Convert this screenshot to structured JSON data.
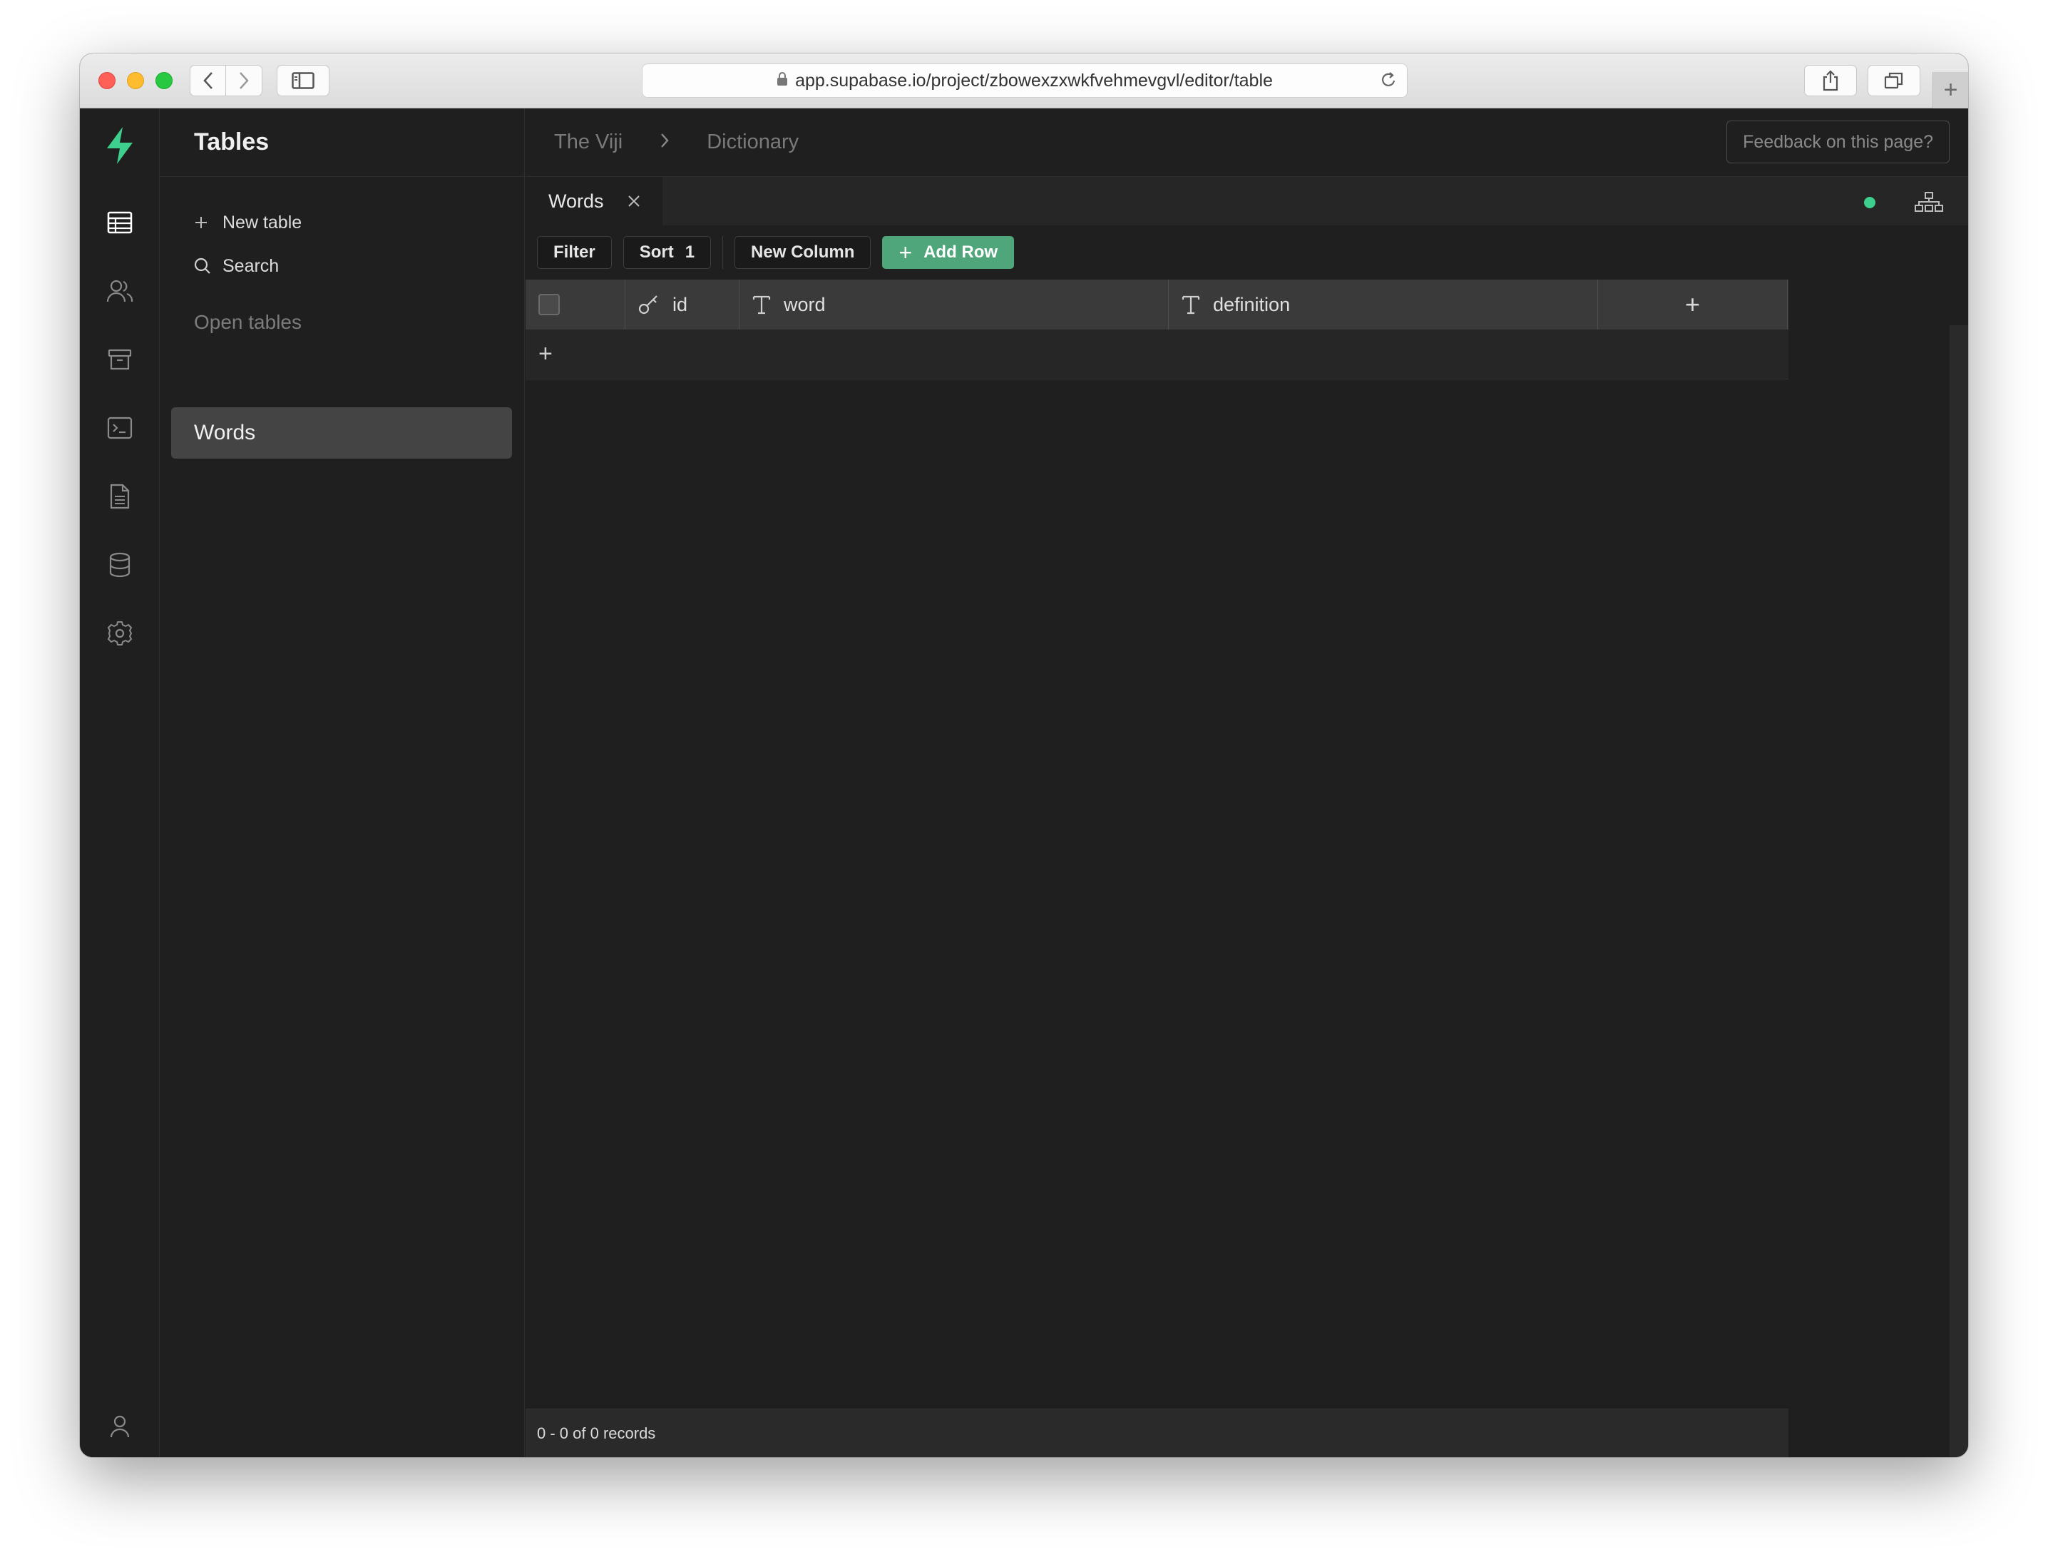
{
  "browser": {
    "url": "app.supabase.io/project/zbowexzxwkfvehmevgvl/editor/table"
  },
  "sidebar_panel": {
    "title": "Tables",
    "new_table_label": "New table",
    "search_label": "Search",
    "open_tables_label": "Open tables",
    "open_tables": [
      {
        "label": "Words"
      }
    ]
  },
  "topbar": {
    "breadcrumb": [
      "The Viji",
      "Dictionary"
    ],
    "feedback_label": "Feedback on this page?"
  },
  "tabs": [
    {
      "label": "Words"
    }
  ],
  "toolbar": {
    "filter_label": "Filter",
    "sort_label": "Sort",
    "sort_count": "1",
    "new_column_label": "New Column",
    "add_row_label": "Add Row"
  },
  "grid": {
    "columns": [
      {
        "name": "id",
        "type_icon": "key-icon"
      },
      {
        "name": "word",
        "type_icon": "text-type-icon"
      },
      {
        "name": "definition",
        "type_icon": "text-type-icon"
      }
    ],
    "add_column_glyph": "+",
    "add_row_glyph": "+"
  },
  "footer": {
    "records_text": "0 - 0 of 0 records"
  },
  "colors": {
    "accent": "#3ecf8e",
    "add_row_button": "#4fa67b",
    "background": "#1f1f1f",
    "header_row": "#3a3a3a"
  }
}
